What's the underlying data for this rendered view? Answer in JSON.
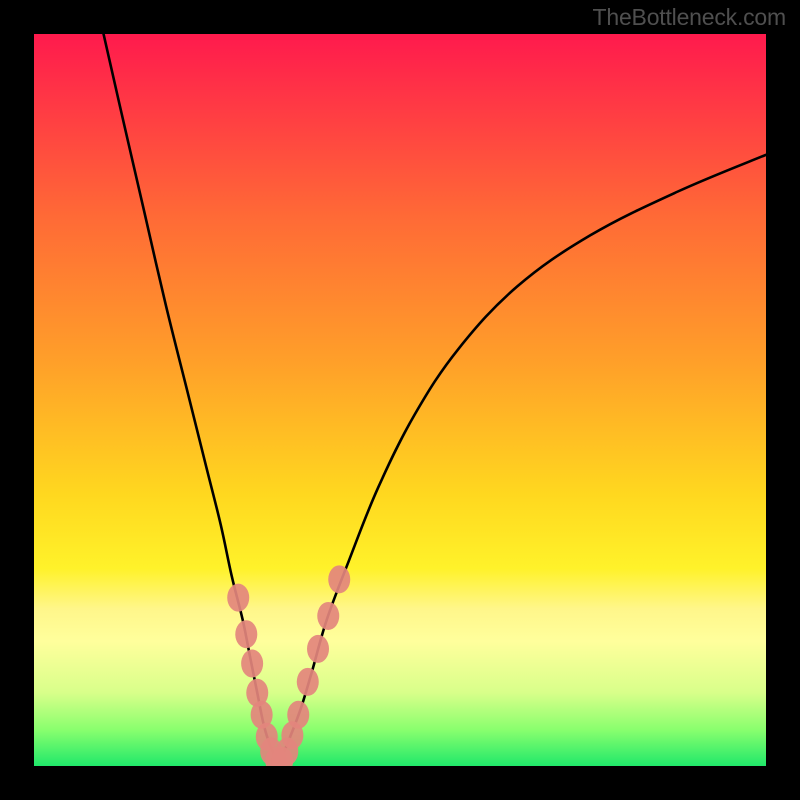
{
  "attribution": "TheBottleneck.com",
  "colors": {
    "border": "#000000",
    "gradient_top": "#ff1a4d",
    "gradient_bottom": "#20e86a",
    "curve": "#000000",
    "marker": "#e3857d"
  },
  "chart_data": {
    "type": "line",
    "title": "",
    "xlabel": "",
    "ylabel": "",
    "xlim": [
      0,
      100
    ],
    "ylim": [
      0,
      100
    ],
    "series": [
      {
        "name": "left-branch",
        "x": [
          9.5,
          12,
          15,
          18,
          21,
          23.5,
          25.5,
          27,
          28.5,
          29.5,
          30.5,
          31.3,
          32,
          32.7,
          33.3
        ],
        "y": [
          100,
          89,
          76,
          63,
          51,
          41,
          33,
          26,
          20,
          15,
          10,
          6,
          3.5,
          1.8,
          0.5
        ]
      },
      {
        "name": "right-branch",
        "x": [
          33.3,
          34,
          35,
          36.5,
          38,
          40,
          43,
          47,
          52,
          58,
          66,
          76,
          88,
          100
        ],
        "y": [
          0.5,
          1.6,
          4,
          8,
          13,
          20,
          28,
          38,
          48,
          57,
          65.5,
          72.5,
          78.5,
          83.5
        ]
      }
    ],
    "markers": {
      "name": "highlighted-points",
      "color": "#e3857d",
      "points": [
        {
          "x": 27.9,
          "y": 23.0
        },
        {
          "x": 29.0,
          "y": 18.0
        },
        {
          "x": 29.8,
          "y": 14.0
        },
        {
          "x": 30.5,
          "y": 10.0
        },
        {
          "x": 31.1,
          "y": 7.0
        },
        {
          "x": 31.8,
          "y": 4.0
        },
        {
          "x": 32.4,
          "y": 2.0
        },
        {
          "x": 33.1,
          "y": 0.7
        },
        {
          "x": 33.9,
          "y": 0.7
        },
        {
          "x": 34.6,
          "y": 2.0
        },
        {
          "x": 35.3,
          "y": 4.2
        },
        {
          "x": 36.1,
          "y": 7.0
        },
        {
          "x": 37.4,
          "y": 11.5
        },
        {
          "x": 38.8,
          "y": 16.0
        },
        {
          "x": 40.2,
          "y": 20.5
        },
        {
          "x": 41.7,
          "y": 25.5
        }
      ]
    }
  }
}
